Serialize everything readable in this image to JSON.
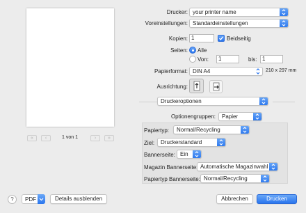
{
  "preview": {
    "page_indicator": "1 von 1",
    "nav": {
      "first": "«",
      "prev": "‹",
      "next": "›",
      "last": "»"
    }
  },
  "printer": {
    "label": "Drucker:",
    "value": "your printer name"
  },
  "presets": {
    "label": "Voreinstellungen:",
    "value": "Standardeinstellungen"
  },
  "copies": {
    "label": "Kopien:",
    "value": "1",
    "duplex_label": "Beidseitig"
  },
  "pages": {
    "label": "Seiten:",
    "all_label": "Alle",
    "from_label": "Von:",
    "from_value": "1",
    "to_label": "bis:",
    "to_value": "1"
  },
  "paper": {
    "label": "Papierformat:",
    "value": "DIN A4",
    "size_note": "210 x 297 mm"
  },
  "orientation": {
    "label": "Ausrichtung:"
  },
  "section": {
    "value": "Druckeroptionen"
  },
  "option_groups": {
    "label": "Optionengruppen:",
    "value": "Papier"
  },
  "options": [
    {
      "label": "Papiertyp:",
      "value": "Normal/Recycling"
    },
    {
      "label": "Ziel:",
      "value": "Druckerstandard"
    },
    {
      "label": "Bannerseite:",
      "value": "Ein"
    },
    {
      "label": "Magazin Bannerseite:",
      "value": "Automatische Magazinwahl"
    },
    {
      "label": "Papiertyp Bannerseite:",
      "value": "Normal/Recycling"
    }
  ],
  "footer": {
    "help": "?",
    "pdf": "PDF",
    "details": "Details ausblenden",
    "cancel": "Abbrechen",
    "print": "Drucken"
  },
  "colors": {
    "accent": "#2a76ee",
    "background": "#ececec"
  }
}
